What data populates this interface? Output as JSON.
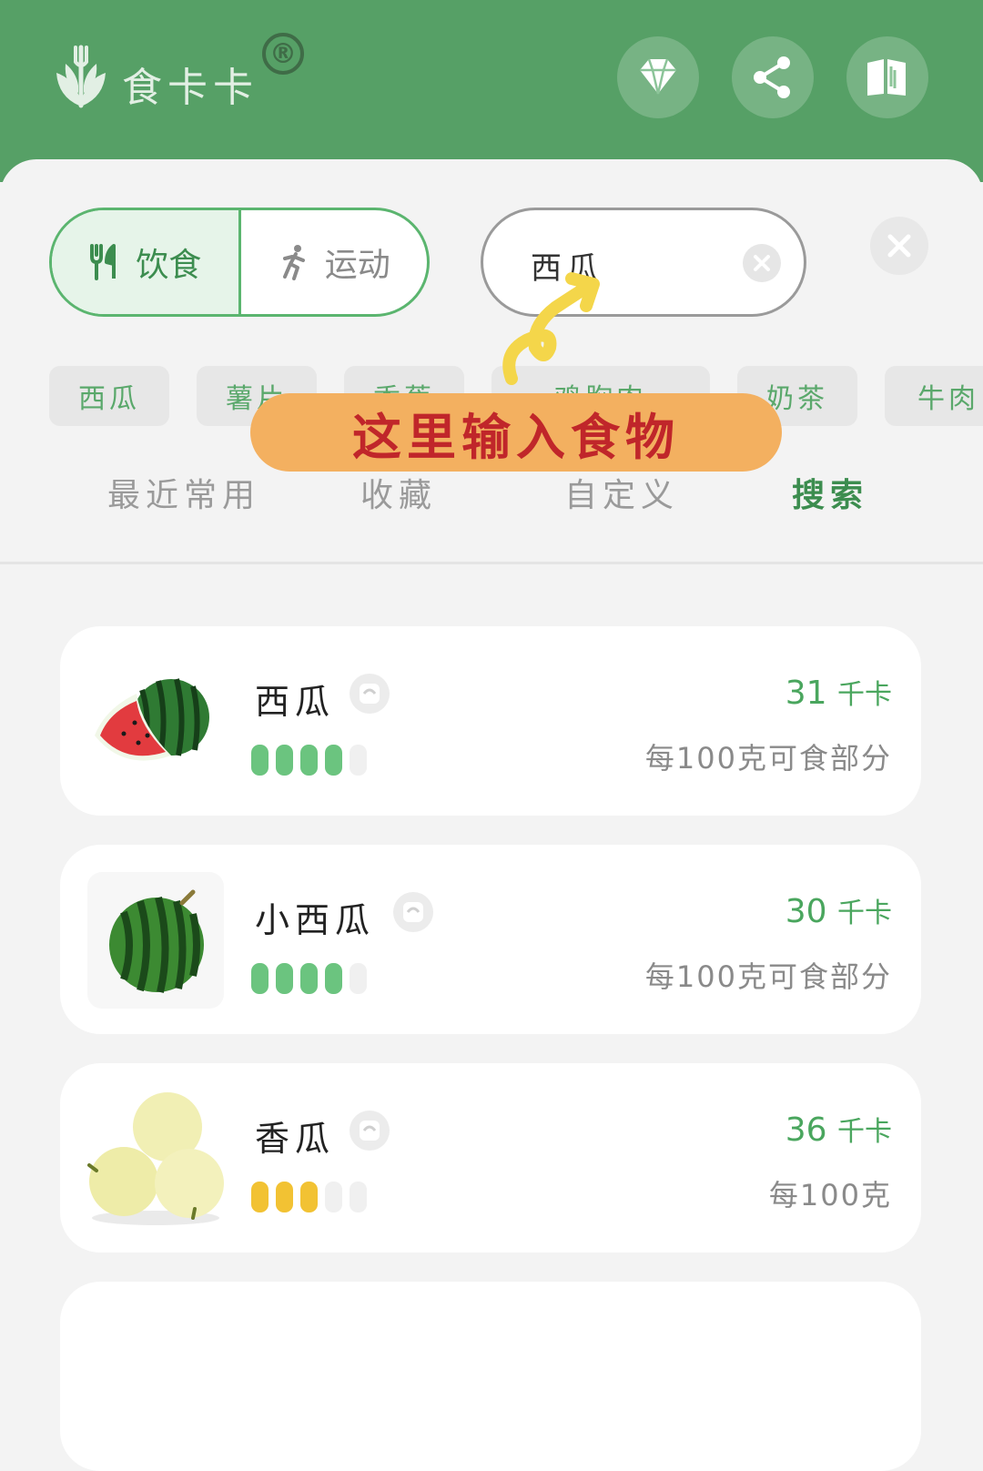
{
  "app": {
    "logo_text": "食卡卡",
    "registered_mark": "®"
  },
  "header_buttons": [
    "diamond-icon",
    "share-icon",
    "book-icon"
  ],
  "mode_toggle": {
    "diet_label": "饮食",
    "exercise_label": "运动",
    "active": "diet"
  },
  "search": {
    "value": "西瓜"
  },
  "chips": [
    "西瓜",
    "薯片",
    "香蕉",
    "鸡胸肉",
    "奶茶",
    "牛肉"
  ],
  "annotation": "这里输入食物",
  "tabs": [
    "最近常用",
    "收藏",
    "自定义",
    "搜索"
  ],
  "active_tab": "搜索",
  "foods": [
    {
      "name": "西瓜",
      "calories": "31",
      "cal_unit": "千卡",
      "basis": "每100克可食部分",
      "rating": 4,
      "rating_color": "green"
    },
    {
      "name": "小西瓜",
      "calories": "30",
      "cal_unit": "千卡",
      "basis": "每100克可食部分",
      "rating": 4,
      "rating_color": "green"
    },
    {
      "name": "香瓜",
      "calories": "36",
      "cal_unit": "千卡",
      "basis": "每100克",
      "rating": 3,
      "rating_color": "yellow"
    }
  ],
  "colors": {
    "header_green": "#56a066",
    "accent_green": "#4aa65e",
    "annotation_bg": "#f3b060",
    "annotation_text": "#c0262a"
  }
}
